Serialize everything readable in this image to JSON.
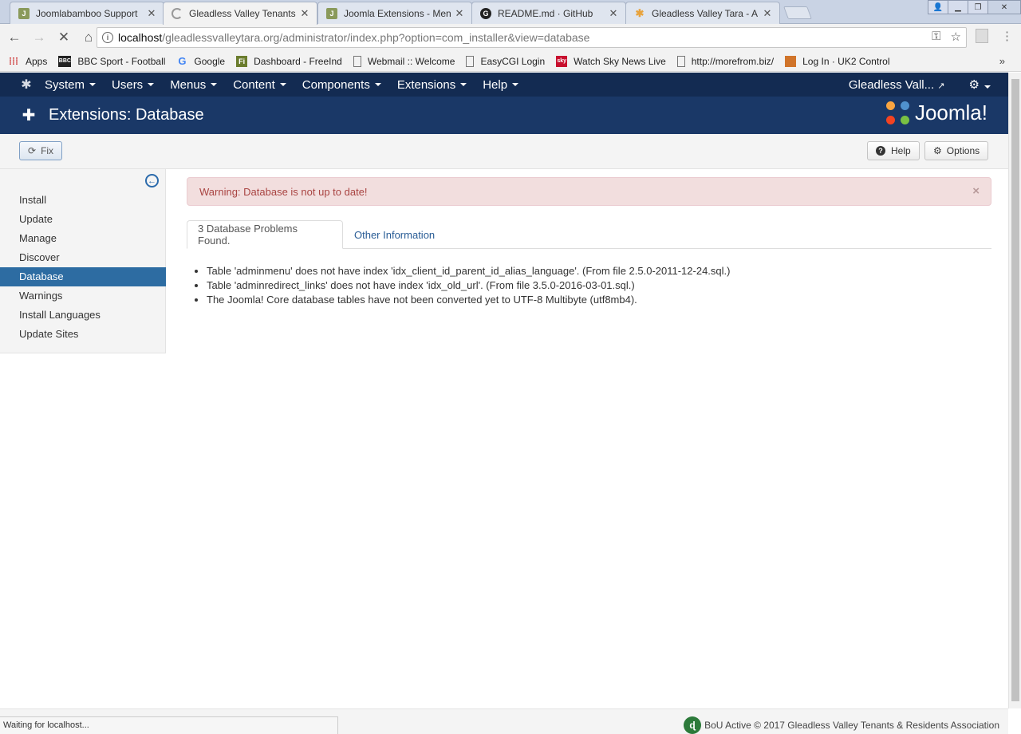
{
  "browser": {
    "tabs": [
      {
        "title": "Joomlabamboo Support",
        "favicon_color": "#8a9a5b",
        "favicon": "J",
        "active": false
      },
      {
        "title": "Gleadless Valley Tenants",
        "favicon_color": "#ffffff",
        "favicon": "",
        "active": true
      },
      {
        "title": "Joomla Extensions - Men",
        "favicon_color": "#8a9a5b",
        "favicon": "J",
        "active": false
      },
      {
        "title": "README.md · GitHub",
        "favicon_color": "#222222",
        "favicon": "G",
        "active": false
      },
      {
        "title": "Gleadless Valley Tara - A",
        "favicon_color": "#e8a33d",
        "favicon": "✱",
        "active": false
      }
    ],
    "url_host": "localhost",
    "url_rest": "/gleadlessvalleytara.org/administrator/index.php?option=com_installer&view=database",
    "bookmarks": [
      {
        "label": "Apps",
        "icon": "apps-grid-icon"
      },
      {
        "label": "BBC Sport - Football",
        "icon": "bbc-icon"
      },
      {
        "label": "Google",
        "icon": "google-icon"
      },
      {
        "label": "Dashboard - FreeInd",
        "icon": "freeindex-icon"
      },
      {
        "label": "Webmail :: Welcome",
        "icon": "page-icon"
      },
      {
        "label": "EasyCGI Login",
        "icon": "page-icon"
      },
      {
        "label": "Watch Sky News Live",
        "icon": "sky-news-icon"
      },
      {
        "label": "http://morefrom.biz/",
        "icon": "page-icon"
      },
      {
        "label": "Log In · UK2 Control",
        "icon": "uk2-icon"
      }
    ],
    "status": "Waiting for localhost..."
  },
  "admin": {
    "menu": [
      "System",
      "Users",
      "Menus",
      "Content",
      "Components",
      "Extensions",
      "Help"
    ],
    "site_name": "Gleadless Vall...",
    "page_title": "Extensions: Database",
    "brand": "Joomla!",
    "toolbar": {
      "fix": "Fix",
      "help": "Help",
      "options": "Options"
    },
    "sidebar": [
      {
        "label": "Install",
        "active": false
      },
      {
        "label": "Update",
        "active": false
      },
      {
        "label": "Manage",
        "active": false
      },
      {
        "label": "Discover",
        "active": false
      },
      {
        "label": "Database",
        "active": true
      },
      {
        "label": "Warnings",
        "active": false
      },
      {
        "label": "Install Languages",
        "active": false
      },
      {
        "label": "Update Sites",
        "active": false
      }
    ],
    "alert": "Warning: Database is not up to date!",
    "tabs": {
      "problems": "3 Database Problems Found.",
      "other": "Other Information"
    },
    "problems": [
      "Table 'adminmenu' does not have index 'idx_client_id_parent_id_alias_language'. (From file 2.5.0-2011-12-24.sql.)",
      "Table 'adminredirect_links' does not have index 'idx_old_url'. (From file 3.5.0-2016-03-01.sql.)",
      "The Joomla! Core database tables have not been converted yet to UTF-8 Multibyte (utf8mb4)."
    ],
    "footer": "BoU Active © 2017 Gleadless Valley Tenants & Residents Association"
  },
  "colors": {
    "nav": "#132b52",
    "header": "#1a3867",
    "active": "#2d6ca2",
    "alert_bg": "#f2dede",
    "alert_text": "#a94442"
  }
}
